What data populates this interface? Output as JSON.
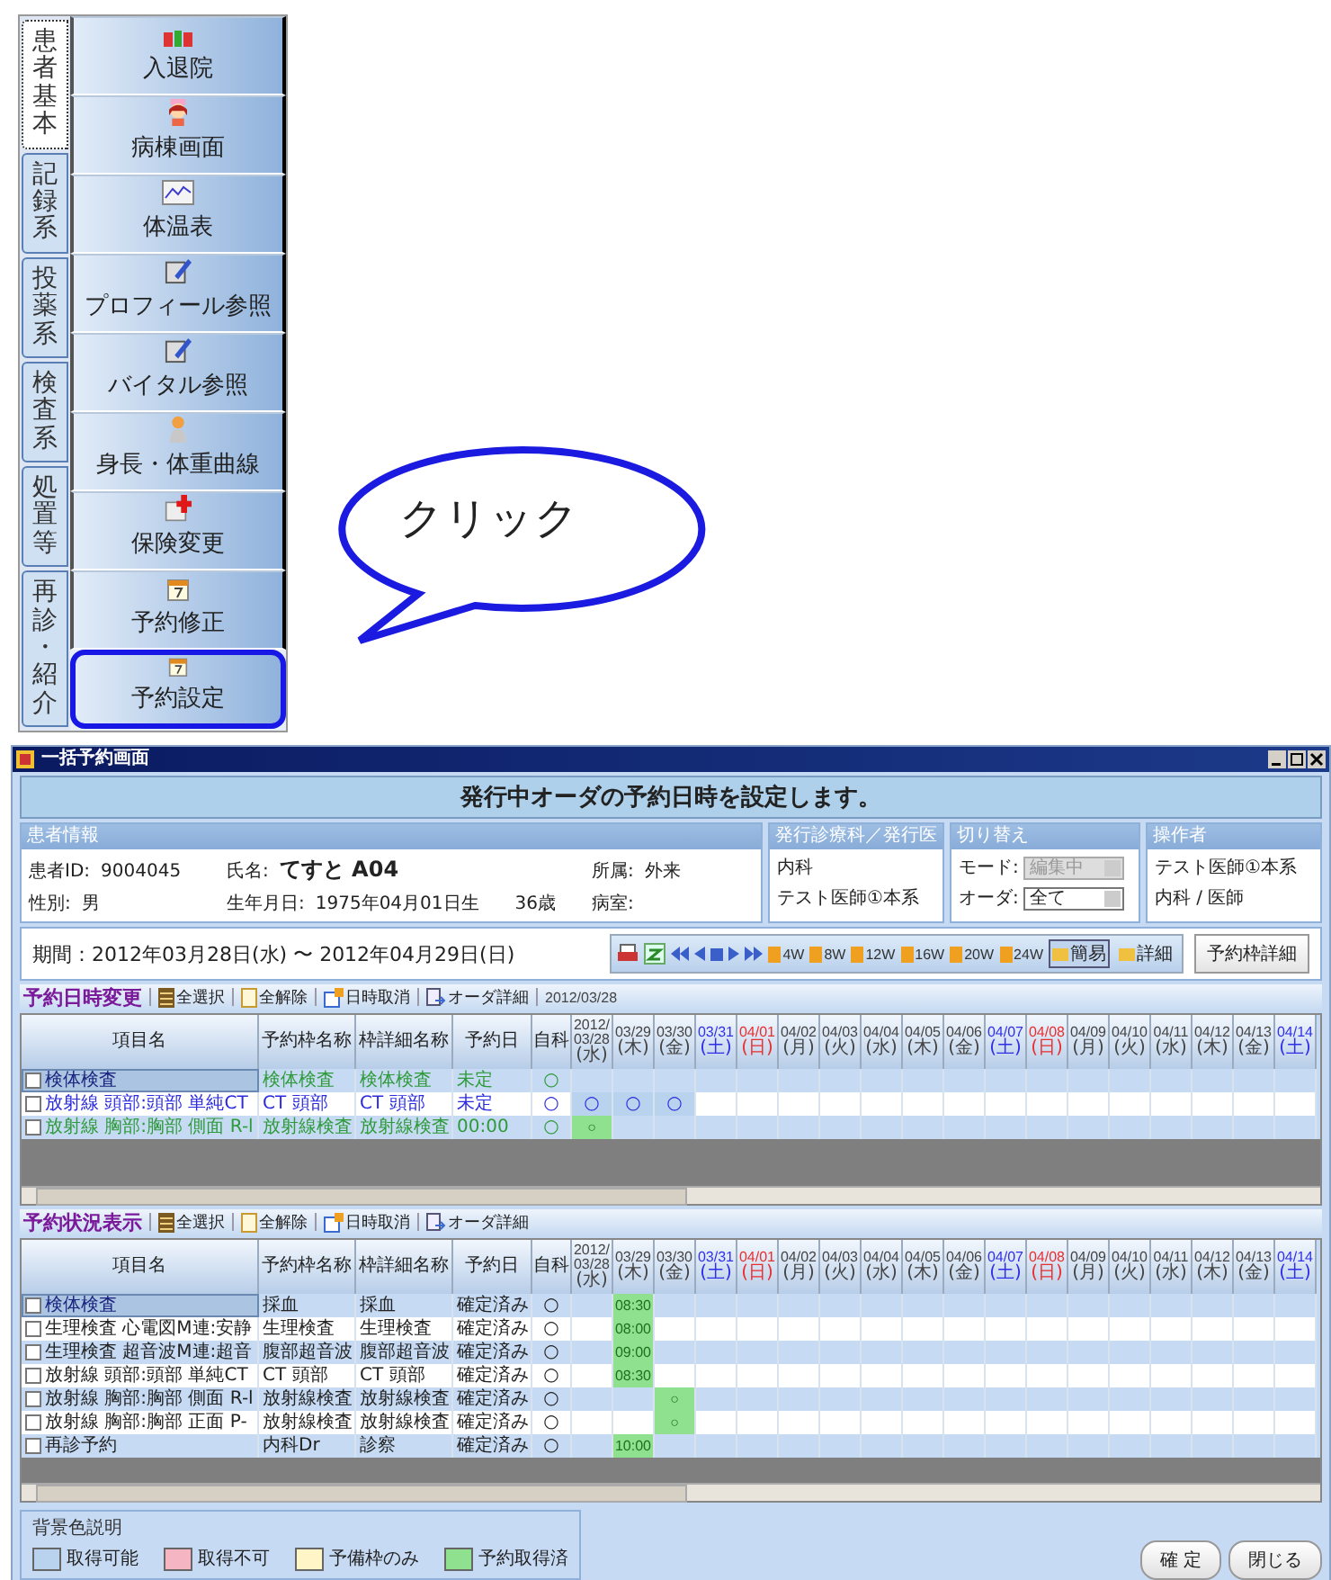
{
  "side_tabs": [
    {
      "label": "患者基本",
      "selected": true
    },
    {
      "label": "記録系",
      "selected": false
    },
    {
      "label": "投薬系",
      "selected": false
    },
    {
      "label": "検査系",
      "selected": false
    },
    {
      "label": "処置等",
      "selected": false
    },
    {
      "label": "再診・紹介",
      "selected": false
    }
  ],
  "menu_items": [
    {
      "label": "入退院",
      "kind": "figures",
      "selected": false
    },
    {
      "label": "病棟画面",
      "kind": "nurse",
      "selected": false
    },
    {
      "label": "体温表",
      "kind": "chart",
      "selected": false
    },
    {
      "label": "プロフィール参照",
      "kind": "note",
      "selected": false
    },
    {
      "label": "バイタル参照",
      "kind": "note",
      "selected": false
    },
    {
      "label": "身長・体重曲線",
      "kind": "person",
      "selected": false
    },
    {
      "label": "保険変更",
      "kind": "medical",
      "selected": false
    },
    {
      "label": "予約修正",
      "kind": "calendar",
      "selected": false
    },
    {
      "label": "予約設定",
      "kind": "calendar",
      "selected": true
    }
  ],
  "callout": {
    "text": "クリック"
  },
  "window": {
    "title": "一括予約画面",
    "banner": "発行中オーダの予約日時を設定します。",
    "patient_panel": {
      "heading": "患者情報",
      "rows": [
        [
          {
            "label": "患者ID:",
            "value": "9004045"
          },
          {
            "label": "氏名:",
            "value": "てすと A04",
            "emphasis": true
          },
          {
            "label": "所属:",
            "value": "外来"
          }
        ],
        [
          {
            "label": "性別:",
            "value": "男"
          },
          {
            "label": "生年月日:",
            "value": "1975年04月01日生",
            "note": "36歳"
          },
          {
            "label": "病室:"
          }
        ]
      ]
    },
    "dept_panel": {
      "heading": "発行診療科／発行医",
      "lines": [
        "内科",
        "テスト医師①本系"
      ]
    },
    "switch_panel": {
      "heading": "切り替え",
      "controls": [
        {
          "label": "モード:",
          "value": "編集中",
          "disabled": true
        },
        {
          "label": "オーダ:",
          "value": "全て",
          "disabled": false
        }
      ]
    },
    "operator_panel": {
      "heading": "操作者",
      "lines": [
        "テスト医師①本系",
        "内科 / 医師"
      ]
    },
    "period": "期間：2012年03月28日(水) 〜 2012年04月29日(日)",
    "nav_buttons": [
      {
        "kind": "print"
      },
      {
        "kind": "refresh"
      },
      {
        "kind": "first"
      },
      {
        "kind": "prev"
      },
      {
        "kind": "stop"
      },
      {
        "kind": "next"
      },
      {
        "kind": "last"
      }
    ],
    "span_buttons": [
      "4W",
      "8W",
      "12W",
      "16W",
      "20W",
      "24W"
    ],
    "mode_buttons": [
      {
        "label": "簡易",
        "selected": true
      },
      {
        "label": "詳細",
        "selected": false
      }
    ],
    "detail_button": "予約枠詳細",
    "change_table": {
      "title": "予約日時変更",
      "date_note": "2012/03/28",
      "tools": [
        {
          "label": "全選択",
          "kind": "select-all"
        },
        {
          "label": "全解除",
          "kind": "clear"
        },
        {
          "label": "日時取消",
          "kind": "cancel"
        },
        {
          "label": "オーダ詳細",
          "kind": "detail"
        }
      ],
      "columns": [
        "項目名",
        "予約枠名称",
        "枠詳細名称",
        "予約日",
        "自科"
      ],
      "dates": [
        {
          "year": "2012/",
          "date": "03/28",
          "day": "(水)",
          "color": "#444444"
        },
        {
          "date": "03/29",
          "day": "(木)",
          "color": "#444444"
        },
        {
          "date": "03/30",
          "day": "(金)",
          "color": "#444444"
        },
        {
          "date": "03/31",
          "day": "(土)",
          "color": "#2f2fe8"
        },
        {
          "date": "04/01",
          "day": "(日)",
          "color": "#e82f2f"
        },
        {
          "date": "04/02",
          "day": "(月)",
          "color": "#444444"
        },
        {
          "date": "04/03",
          "day": "(火)",
          "color": "#444444"
        },
        {
          "date": "04/04",
          "day": "(水)",
          "color": "#444444"
        },
        {
          "date": "04/05",
          "day": "(木)",
          "color": "#444444"
        },
        {
          "date": "04/06",
          "day": "(金)",
          "color": "#444444"
        },
        {
          "date": "04/07",
          "day": "(土)",
          "color": "#2f2fe8"
        },
        {
          "date": "04/08",
          "day": "(日)",
          "color": "#e82f2f"
        },
        {
          "date": "04/09",
          "day": "(月)",
          "color": "#444444"
        },
        {
          "date": "04/10",
          "day": "(火)",
          "color": "#444444"
        },
        {
          "date": "04/11",
          "day": "(水)",
          "color": "#444444"
        },
        {
          "date": "04/12",
          "day": "(木)",
          "color": "#444444"
        },
        {
          "date": "04/13",
          "day": "(金)",
          "color": "#444444"
        },
        {
          "date": "04/14",
          "day": "(土)",
          "color": "#2f2fe8"
        }
      ],
      "rows": [
        {
          "checked": false,
          "selected": true,
          "color": "#2e9a3a",
          "cells": [
            "検体検査",
            "検体検査",
            "検体検査",
            "未定",
            "○"
          ],
          "slots": []
        },
        {
          "checked": false,
          "selected": false,
          "color": "#2a2ae0",
          "cells": [
            "放射線 頭部:頭部 単純CT",
            "CT 頭部",
            "CT 頭部",
            "未定",
            "○"
          ],
          "slots": [
            {
              "kind": "available",
              "text": "○"
            },
            {
              "kind": "available",
              "text": "○"
            },
            {
              "kind": "available",
              "text": "○"
            }
          ]
        },
        {
          "checked": false,
          "selected": false,
          "color": "#2e9a3a",
          "cells": [
            "放射線 胸部:胸部 側面 R-l",
            "放射線検査",
            "放射線検査",
            "00:00",
            "○"
          ],
          "slots": [
            {
              "kind": "booked",
              "text": "○"
            }
          ]
        }
      ]
    },
    "status_table": {
      "title": "予約状況表示",
      "tools": [
        {
          "label": "全選択",
          "kind": "select-all"
        },
        {
          "label": "全解除",
          "kind": "clear"
        },
        {
          "label": "日時取消",
          "kind": "cancel"
        },
        {
          "label": "オーダ詳細",
          "kind": "detail"
        }
      ],
      "columns": [
        "項目名",
        "予約枠名称",
        "枠詳細名称",
        "予約日",
        "自科"
      ],
      "dates": [
        {
          "year": "2012/",
          "date": "03/28",
          "day": "(水)",
          "color": "#444444"
        },
        {
          "date": "03/29",
          "day": "(木)",
          "color": "#444444"
        },
        {
          "date": "03/30",
          "day": "(金)",
          "color": "#444444"
        },
        {
          "date": "03/31",
          "day": "(土)",
          "color": "#2f2fe8"
        },
        {
          "date": "04/01",
          "day": "(日)",
          "color": "#e82f2f"
        },
        {
          "date": "04/02",
          "day": "(月)",
          "color": "#444444"
        },
        {
          "date": "04/03",
          "day": "(火)",
          "color": "#444444"
        },
        {
          "date": "04/04",
          "day": "(水)",
          "color": "#444444"
        },
        {
          "date": "04/05",
          "day": "(木)",
          "color": "#444444"
        },
        {
          "date": "04/06",
          "day": "(金)",
          "color": "#444444"
        },
        {
          "date": "04/07",
          "day": "(土)",
          "color": "#2f2fe8"
        },
        {
          "date": "04/08",
          "day": "(日)",
          "color": "#e82f2f"
        },
        {
          "date": "04/09",
          "day": "(月)",
          "color": "#444444"
        },
        {
          "date": "04/10",
          "day": "(火)",
          "color": "#444444"
        },
        {
          "date": "04/11",
          "day": "(水)",
          "color": "#444444"
        },
        {
          "date": "04/12",
          "day": "(木)",
          "color": "#444444"
        },
        {
          "date": "04/13",
          "day": "(金)",
          "color": "#444444"
        },
        {
          "date": "04/14",
          "day": "(土)",
          "color": "#2f2fe8"
        }
      ],
      "rows": [
        {
          "checked": false,
          "selected": true,
          "color": "#222222",
          "cells": [
            "検体検査",
            "採血",
            "採血",
            "確定済み",
            "○"
          ],
          "slots": [
            {
              "kind": "empty"
            },
            {
              "kind": "booked",
              "text": "08:30"
            }
          ]
        },
        {
          "checked": false,
          "selected": false,
          "color": "#222222",
          "cells": [
            "生理検査 心電図M連:安静",
            "生理検査",
            "生理検査",
            "確定済み",
            "○"
          ],
          "slots": [
            {
              "kind": "empty"
            },
            {
              "kind": "booked",
              "text": "08:00"
            }
          ]
        },
        {
          "checked": false,
          "selected": false,
          "color": "#222222",
          "cells": [
            "生理検査 超音波M連:超音",
            "腹部超音波",
            "腹部超音波",
            "確定済み",
            "○"
          ],
          "slots": [
            {
              "kind": "empty"
            },
            {
              "kind": "booked",
              "text": "09:00"
            }
          ]
        },
        {
          "checked": false,
          "selected": false,
          "color": "#222222",
          "cells": [
            "放射線 頭部:頭部 単純CT",
            "CT 頭部",
            "CT 頭部",
            "確定済み",
            "○"
          ],
          "slots": [
            {
              "kind": "empty"
            },
            {
              "kind": "booked",
              "text": "08:30"
            }
          ]
        },
        {
          "checked": false,
          "selected": false,
          "color": "#222222",
          "cells": [
            "放射線 胸部:胸部 側面 R-l",
            "放射線検査",
            "放射線検査",
            "確定済み",
            "○"
          ],
          "slots": [
            {
              "kind": "empty"
            },
            {
              "kind": "empty"
            },
            {
              "kind": "booked",
              "text": "○"
            }
          ]
        },
        {
          "checked": false,
          "selected": false,
          "color": "#222222",
          "cells": [
            "放射線 胸部:胸部 正面 P-",
            "放射線検査",
            "放射線検査",
            "確定済み",
            "○"
          ],
          "slots": [
            {
              "kind": "empty"
            },
            {
              "kind": "empty"
            },
            {
              "kind": "booked",
              "text": "○"
            }
          ]
        },
        {
          "checked": false,
          "selected": false,
          "color": "#222222",
          "cells": [
            "再診予約",
            "内科Dr",
            "診察",
            "確定済み",
            "○"
          ],
          "slots": [
            {
              "kind": "empty"
            },
            {
              "kind": "booked",
              "text": "10:00"
            }
          ]
        }
      ]
    },
    "legend": {
      "title": "背景色説明",
      "items": [
        {
          "label": "取得可能",
          "color": "#b9d3ee"
        },
        {
          "label": "取得不可",
          "color": "#f5b5c2"
        },
        {
          "label": "予備枠のみ",
          "color": "#fff5c6"
        },
        {
          "label": "予約取得済",
          "color": "#8fe08f"
        }
      ]
    },
    "buttons": [
      "確 定",
      "閉じる"
    ]
  }
}
